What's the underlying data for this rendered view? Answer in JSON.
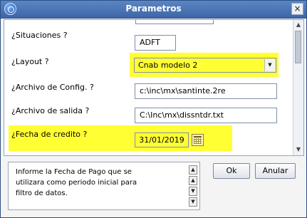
{
  "window": {
    "title": "Parametros",
    "close_symbol": "×"
  },
  "form": {
    "situaciones": {
      "label": "¿Situaciones ?",
      "value": "ADFT"
    },
    "layout": {
      "label": "¿Layout ?",
      "value": "Cnab modelo 2",
      "highlight_color": "#ffff33"
    },
    "archivo_config": {
      "label": "¿Archivo de Config. ?",
      "value": "c:\\inc\\mx\\santinte.2re"
    },
    "archivo_salida": {
      "label": "¿Archivo de salida ?",
      "value": "C:\\Inc\\mx\\dissntdr.txt"
    },
    "fecha_credito": {
      "label": "¿Fecha de credito ?",
      "value": "31/01/2019",
      "highlight_color": "#ffff33"
    }
  },
  "help": {
    "text": "Informe la Fecha de Pago que se\nutilizara como periodo  inicial para\nfiltro de datos."
  },
  "buttons": {
    "ok_label": "Ok",
    "anular_label": "Anular"
  },
  "icons": {
    "app": "app-globe-icon",
    "close": "close-icon",
    "dropdown": "chevron-down-icon",
    "calendar": "calendar-icon"
  }
}
